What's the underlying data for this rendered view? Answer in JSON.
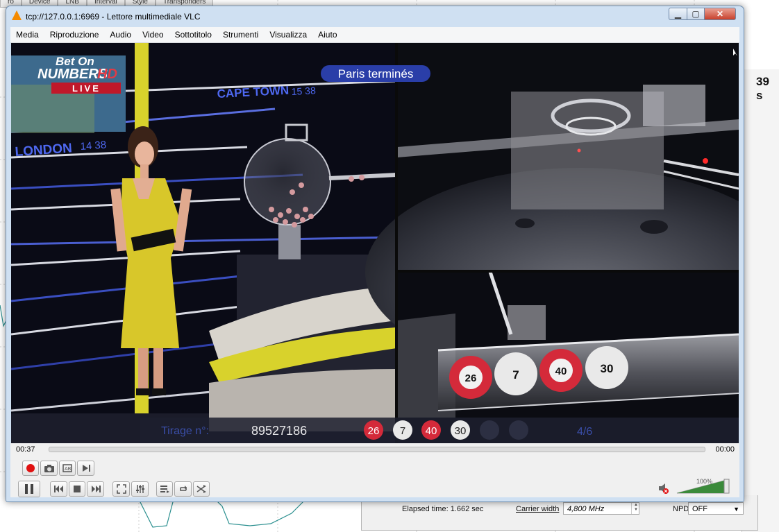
{
  "background_app": {
    "tabs": [
      "ro",
      "Device",
      "LNB",
      "Interval",
      "Style",
      "Transponders"
    ],
    "seconds_fragment": "39 s",
    "elapsed_time": "Elapsed time: 1.662 sec",
    "carrier_width_label": "Carrier width",
    "carrier_width_value": "4,800 MHz",
    "npd_label": "NPD",
    "npd_value": "OFF"
  },
  "window": {
    "title": "tcp://127.0.0.1:6969 - Lettore multimediale VLC",
    "controls": {
      "minimize": "0",
      "maximize": "1",
      "close": "X"
    }
  },
  "menu": [
    "Media",
    "Riproduzione",
    "Audio",
    "Video",
    "Sottotitolo",
    "Strumenti",
    "Visualizza",
    "Aiuto"
  ],
  "video": {
    "logo_line1": "Bet On",
    "logo_line2": "NUMBERS",
    "logo_hd": "HD",
    "logo_live": "LIVE",
    "cape_town": "CAPE TOWN",
    "cape_town_time": "15 38",
    "london": "LONDON",
    "london_time": "14 38",
    "paris_banner": "Paris terminés",
    "tirage_label": "Tirage n°:",
    "tirage_number": "89527186",
    "drawn_balls": [
      {
        "number": "26",
        "color": "red"
      },
      {
        "number": "7",
        "color": "white"
      },
      {
        "number": "40",
        "color": "red"
      },
      {
        "number": "30",
        "color": "white"
      }
    ],
    "empty_slots": 2,
    "progress_text": "4/6",
    "tube_balls": [
      {
        "number": "26",
        "color": "red"
      },
      {
        "number": "7",
        "color": "white"
      },
      {
        "number": "40",
        "color": "red"
      },
      {
        "number": "30",
        "color": "white"
      }
    ]
  },
  "playback": {
    "elapsed": "00:37",
    "total": "00:00",
    "volume": "100%"
  },
  "colors": {
    "ball_red": "#d42a3a",
    "ball_white": "#e9e9e9",
    "presenter_dress": "#d8c72a",
    "banner_blue": "#2a3ea8",
    "volume_green": "#3a8a3a",
    "record_red": "#e01010"
  }
}
